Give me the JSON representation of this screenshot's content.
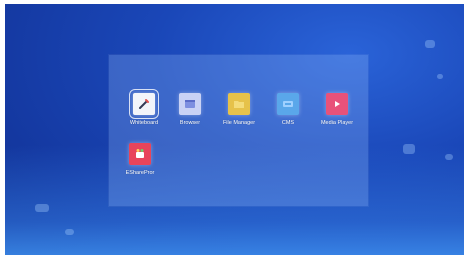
{
  "apps": [
    {
      "label": "Whiteboard",
      "icon": "whiteboard-icon",
      "color": "#f2f4fa",
      "accent": "#333a55"
    },
    {
      "label": "Browser",
      "icon": "browser-icon",
      "color": "#c9d2f5",
      "accent": "#7d8fe0"
    },
    {
      "label": "File Manager",
      "icon": "folder-icon",
      "color": "#e6c24a",
      "accent": "#f4dc7a"
    },
    {
      "label": "CMS",
      "icon": "cms-icon",
      "color": "#5aa7ea",
      "accent": "#9fd0ff"
    },
    {
      "label": "Media Player",
      "icon": "media-player-icon",
      "color": "#e8527a",
      "accent": "#ff9aa8"
    },
    {
      "label": "ESharePror",
      "icon": "eshare-icon",
      "color": "#e8445a",
      "accent": "#ffd35a"
    }
  ],
  "selected_app": "Whiteboard"
}
